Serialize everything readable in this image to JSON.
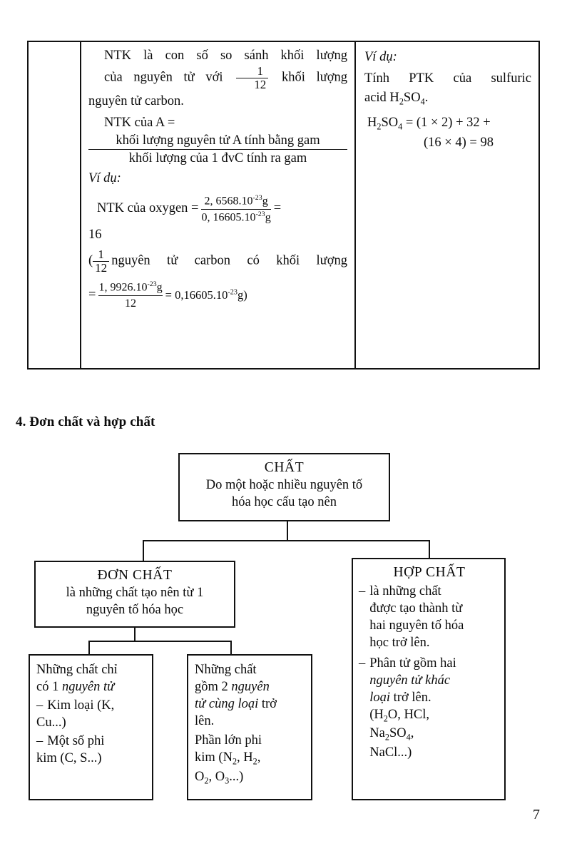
{
  "page": {
    "number": "7",
    "section_heading": "4. Đơn chất và hợp chất"
  },
  "table": {
    "left_column": "",
    "main_column": {
      "p1": "NTK là con số so sánh khối lượng",
      "p2a": "của nguyên tử với",
      "frac1_num": "1",
      "frac1_den": "12",
      "p2b": "khối lượng",
      "p3": "nguyên tử carbon.",
      "p4": "NTK của A =",
      "ntk_num": "khối lượng nguyên tử A tính bằng gam",
      "ntk_den": "khối lượng của 1 đvC tính ra gam",
      "example_label": "Ví dụ:",
      "ox_lead": "NTK của oxygen  =",
      "ox_num_a": "2, 6568.10",
      "ox_num_exp": "-23",
      "ox_num_b": "g",
      "ox_den_a": "0, 16605.10",
      "ox_den_exp": "-23",
      "ox_den_b": "g",
      "ox_eq": "=",
      "ox_result": "16",
      "paren_open": "(",
      "frac2_num": "1",
      "frac2_den": "12",
      "carbon_text": "nguyên tử carbon có khối lượng",
      "last_eq": "=",
      "last_num_a": "1, 9926.10",
      "last_num_exp": "-23",
      "last_num_b": "g",
      "last_den": "12",
      "last_result_a": "= 0,16605.10",
      "last_result_exp": "-23",
      "last_result_b": "g)"
    },
    "example_column": {
      "label": "Ví dụ:",
      "line1": "Tính PTK của sulfuric",
      "line2a": "acid H",
      "line2sub1": "2",
      "line2b": "SO",
      "line2sub2": "4",
      "line2c": ".",
      "calc_a": "H",
      "calc_sub1": "2",
      "calc_b": "SO",
      "calc_sub2": "4",
      "calc_c": " = (1 × 2) + 32 +",
      "calc_line2": "(16 × 4) = 98"
    }
  },
  "diagram": {
    "root": {
      "title": "CHẤT",
      "line1": "Do một hoặc nhiều nguyên tố",
      "line2": "hóa học cấu tạo nên"
    },
    "don_chat": {
      "title": "ĐƠN CHẤT",
      "line1": "là những chất tạo nên từ 1",
      "line2": "nguyên tố hóa học"
    },
    "hop_chat": {
      "title": "HỢP CHẤT",
      "item1_dash": "–",
      "item1_l1": "là những chất",
      "item1_l2": "được tạo thành từ",
      "item1_l3": "hai nguyên tố hóa",
      "item1_l4": "học trở lên.",
      "item2_dash": "–",
      "item2_l1": "Phân tử gồm hai",
      "item2_l2_ital": "nguyên tử khác",
      "item2_l3_ital": "loại",
      "item2_l3_rest": " trở lên.",
      "formula_l1_a": "(H",
      "formula_l1_sub": "2",
      "formula_l1_b": "O, HCl,",
      "formula_l2_a": "Na",
      "formula_l2_sub1": "2",
      "formula_l2_b": "SO",
      "formula_l2_sub2": "4",
      "formula_l2_c": ",",
      "formula_l3": "NaCl...)"
    },
    "sub_left": {
      "l1": "Những chất chỉ",
      "l2_a": "có 1 ",
      "l2_ital": "nguyên tử",
      "d1_dash": "–",
      "d1_l1": "Kim loại (K,",
      "d1_l2": "Cu...)",
      "d2_dash": "–",
      "d2_l1": "Một số phi",
      "d2_l2": "kim (C, S...)"
    },
    "sub_right": {
      "l1": "Những chất",
      "l2_a": "gồm 2 ",
      "l2_ital": "nguyên",
      "l3_ital": "tử cùng loại",
      "l3_rest": " trở",
      "l4": "lên.",
      "l5": "Phần lớn phi",
      "l6_a": "kim (N",
      "l6_sub1": "2",
      "l6_b": ", H",
      "l6_sub2": "2",
      "l6_c": ",",
      "l7_a": "O",
      "l7_sub1": "2",
      "l7_b": ", O",
      "l7_sub2": "3",
      "l7_c": "...)"
    }
  },
  "colors": {
    "ink": "#0b0b0b",
    "rule": "#111111",
    "paper": "#ffffff"
  }
}
